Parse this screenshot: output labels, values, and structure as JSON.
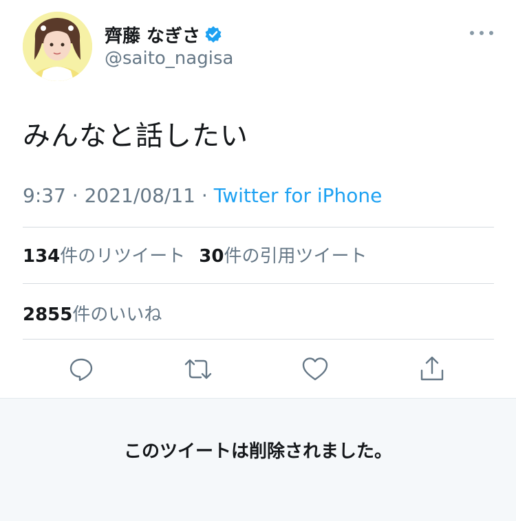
{
  "user": {
    "display_name": "齊藤 なぎさ",
    "handle": "@saito_nagisa",
    "verified": true
  },
  "tweet": {
    "text": "みんなと話したい",
    "time": "9:37",
    "separator": "·",
    "date": "2021/08/11",
    "source": "Twitter for iPhone"
  },
  "stats": {
    "retweets_count": "134",
    "retweets_label": "件のリツイート",
    "quotes_count": "30",
    "quotes_label": "件の引用ツイート",
    "likes_count": "2855",
    "likes_label": "件のいいね"
  },
  "actions": {
    "reply_icon": "reply-icon",
    "retweet_icon": "retweet-icon",
    "like_icon": "heart-icon",
    "share_icon": "share-icon"
  },
  "notice": {
    "deleted_text": "このツイートは削除されました。"
  },
  "colors": {
    "accent": "#1da1f2",
    "text_primary": "#14171a",
    "text_secondary": "#657786",
    "icon": "#657786"
  }
}
